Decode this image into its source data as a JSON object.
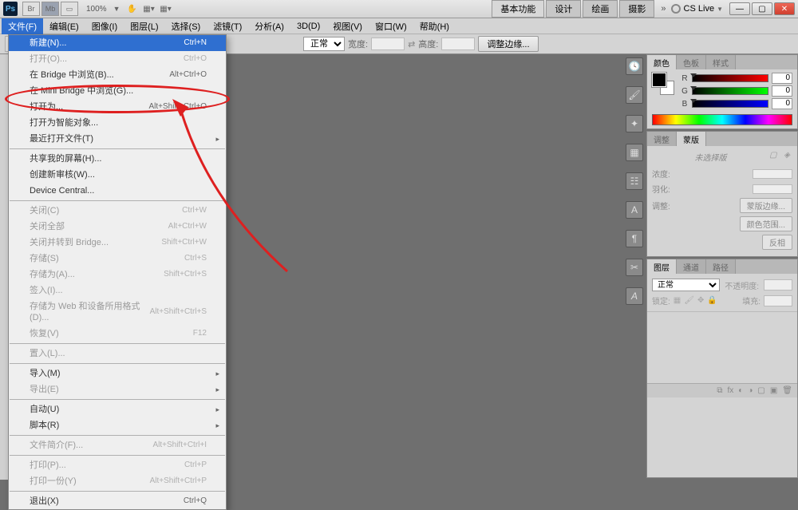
{
  "titlebar": {
    "logo_text": "Ps",
    "btn_br": "Br",
    "btn_mb": "Mb",
    "zoom": "100%",
    "workspace_tabs": [
      "基本功能",
      "设计",
      "绘画",
      "摄影"
    ],
    "cslive": "CS Live"
  },
  "menubar": {
    "items": [
      "文件(F)",
      "编辑(E)",
      "图像(I)",
      "图层(L)",
      "选择(S)",
      "滤镜(T)",
      "分析(A)",
      "3D(D)",
      "视图(V)",
      "窗口(W)",
      "帮助(H)"
    ]
  },
  "optionsbar": {
    "mode": "正常",
    "width_label": "宽度:",
    "swap_icon": "⇄",
    "height_label": "高度:",
    "adjust_edges": "调整边缘..."
  },
  "dropdown": {
    "groups": [
      [
        {
          "label": "新建(N)...",
          "shortcut": "Ctrl+N",
          "state": "highlight"
        },
        {
          "label": "打开(O)...",
          "shortcut": "Ctrl+O",
          "state": "disabled"
        },
        {
          "label": "在 Bridge 中浏览(B)...",
          "shortcut": "Alt+Ctrl+O"
        },
        {
          "label": "在 Mini Bridge 中浏览(G)..."
        },
        {
          "label": "打开为...",
          "shortcut": "Alt+Shift+Ctrl+O"
        },
        {
          "label": "打开为智能对象..."
        },
        {
          "label": "最近打开文件(T)",
          "submenu": true
        }
      ],
      [
        {
          "label": "共享我的屏幕(H)..."
        },
        {
          "label": "创建新审核(W)..."
        },
        {
          "label": "Device Central..."
        }
      ],
      [
        {
          "label": "关闭(C)",
          "shortcut": "Ctrl+W",
          "state": "disabled"
        },
        {
          "label": "关闭全部",
          "shortcut": "Alt+Ctrl+W",
          "state": "disabled"
        },
        {
          "label": "关闭并转到 Bridge...",
          "shortcut": "Shift+Ctrl+W",
          "state": "disabled"
        },
        {
          "label": "存储(S)",
          "shortcut": "Ctrl+S",
          "state": "disabled"
        },
        {
          "label": "存储为(A)...",
          "shortcut": "Shift+Ctrl+S",
          "state": "disabled"
        },
        {
          "label": "签入(I)...",
          "state": "disabled"
        },
        {
          "label": "存储为 Web 和设备所用格式(D)...",
          "shortcut": "Alt+Shift+Ctrl+S",
          "state": "disabled"
        },
        {
          "label": "恢复(V)",
          "shortcut": "F12",
          "state": "disabled"
        }
      ],
      [
        {
          "label": "置入(L)...",
          "state": "disabled"
        }
      ],
      [
        {
          "label": "导入(M)",
          "submenu": true
        },
        {
          "label": "导出(E)",
          "submenu": true,
          "state": "disabled"
        }
      ],
      [
        {
          "label": "自动(U)",
          "submenu": true
        },
        {
          "label": "脚本(R)",
          "submenu": true
        }
      ],
      [
        {
          "label": "文件简介(F)...",
          "shortcut": "Alt+Shift+Ctrl+I",
          "state": "disabled"
        }
      ],
      [
        {
          "label": "打印(P)...",
          "shortcut": "Ctrl+P",
          "state": "disabled"
        },
        {
          "label": "打印一份(Y)",
          "shortcut": "Alt+Shift+Ctrl+P",
          "state": "disabled"
        }
      ],
      [
        {
          "label": "退出(X)",
          "shortcut": "Ctrl+Q"
        }
      ]
    ]
  },
  "panels": {
    "color": {
      "tabs": [
        "颜色",
        "色板",
        "样式"
      ],
      "r_label": "R",
      "g_label": "G",
      "b_label": "B",
      "r_val": "0",
      "g_val": "0",
      "b_val": "0"
    },
    "adjust": {
      "tabs": [
        "调整",
        "蒙版"
      ],
      "placeholder": "未选择版",
      "density_label": "浓度:",
      "feather_label": "羽化:",
      "refine_label": "调整:",
      "btn_mask_edge": "蒙版边缘...",
      "btn_color_range": "颜色范围...",
      "btn_invert": "反相"
    },
    "layers": {
      "tabs": [
        "图层",
        "通道",
        "路径"
      ],
      "blend": "正常",
      "opacity_label": "不透明度:",
      "lock_label": "锁定:",
      "fill_label": "填充:"
    }
  }
}
